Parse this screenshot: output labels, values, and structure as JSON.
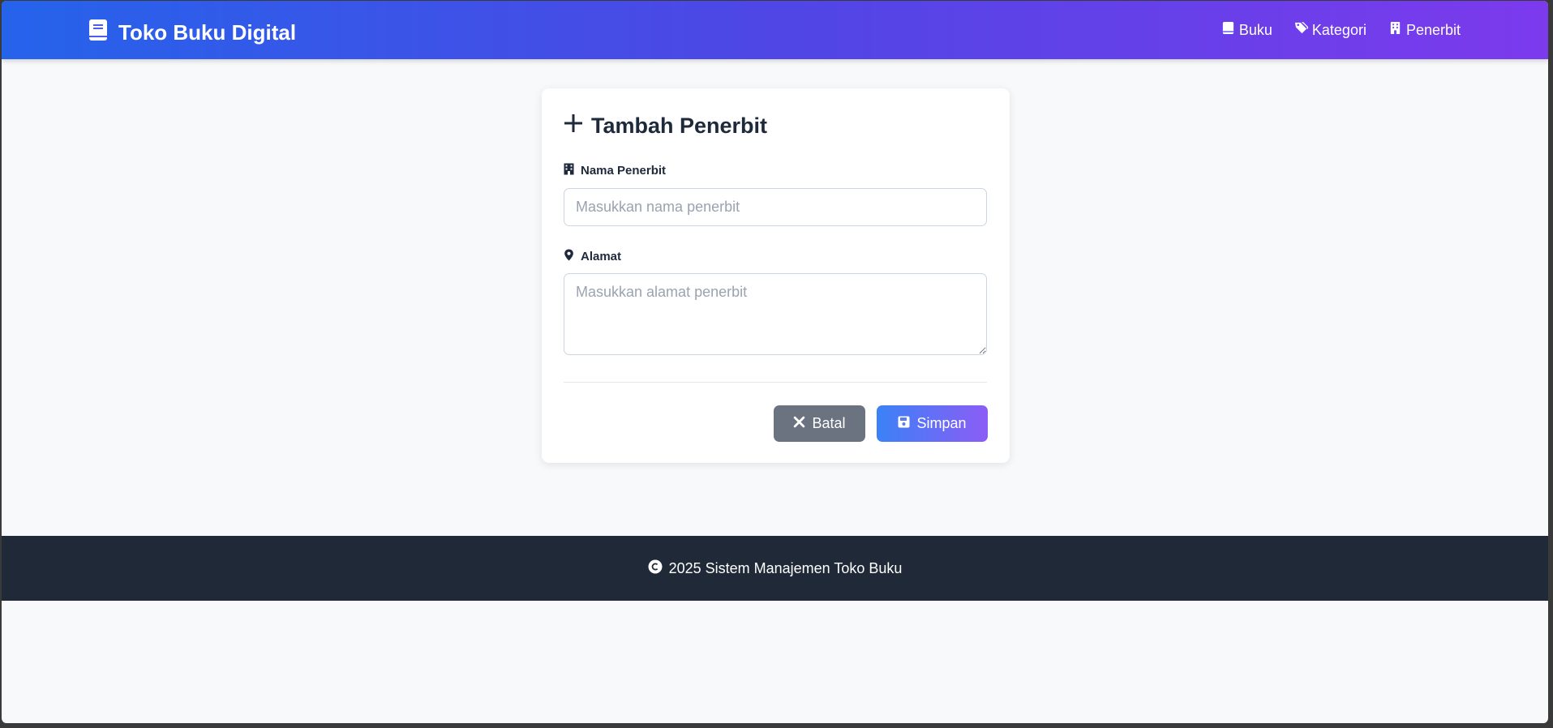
{
  "brand": {
    "title": "Toko Buku Digital",
    "icon": "book-icon"
  },
  "nav": {
    "items": [
      {
        "label": "Buku",
        "icon": "book-icon"
      },
      {
        "label": "Kategori",
        "icon": "tags-icon"
      },
      {
        "label": "Penerbit",
        "icon": "building-icon"
      }
    ]
  },
  "form": {
    "title": "Tambah Penerbit",
    "title_icon": "plus-icon",
    "fields": {
      "nama": {
        "label": "Nama Penerbit",
        "icon": "building-icon",
        "placeholder": "Masukkan nama penerbit",
        "value": ""
      },
      "alamat": {
        "label": "Alamat",
        "icon": "map-pin-icon",
        "placeholder": "Masukkan alamat penerbit",
        "value": ""
      }
    },
    "buttons": {
      "cancel": {
        "label": "Batal",
        "icon": "x-icon"
      },
      "save": {
        "label": "Simpan",
        "icon": "save-icon"
      }
    }
  },
  "footer": {
    "text": "2025 Sistem Manajemen Toko Buku",
    "icon": "copyright-icon"
  },
  "colors": {
    "nav_gradient_start": "#2563eb",
    "nav_gradient_end": "#7c3aed",
    "cancel_button": "#6b7280",
    "save_gradient_start": "#3b82f6",
    "save_gradient_end": "#8b5cf6",
    "footer_bg": "#1f2937",
    "page_bg": "#f8f9fb"
  }
}
